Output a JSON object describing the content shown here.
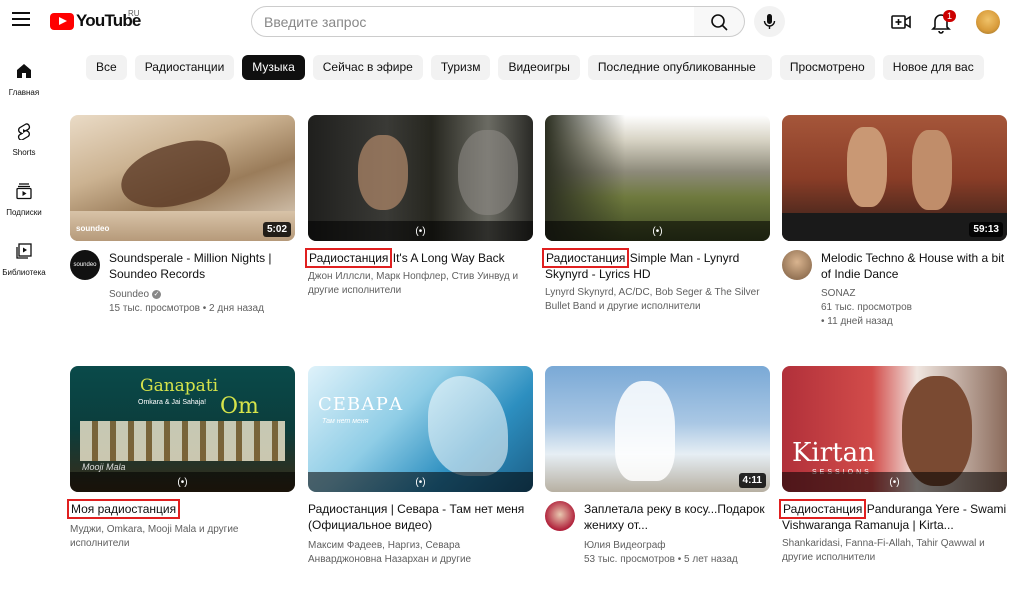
{
  "header": {
    "logo_text": "YouTube",
    "region": "RU",
    "search_placeholder": "Введите запрос",
    "notifications_count": "1"
  },
  "sidebar": {
    "items": [
      {
        "label": "Главная",
        "icon": "home-icon"
      },
      {
        "label": "Shorts",
        "icon": "shorts-icon"
      },
      {
        "label": "Подписки",
        "icon": "subscriptions-icon"
      },
      {
        "label": "Библиотека",
        "icon": "library-icon"
      }
    ]
  },
  "chips": [
    {
      "label": "Все",
      "active": false
    },
    {
      "label": "Радиостанции",
      "active": false
    },
    {
      "label": "Музыка",
      "active": true
    },
    {
      "label": "Сейчас в эфире",
      "active": false
    },
    {
      "label": "Туризм",
      "active": false
    },
    {
      "label": "Видеоигры",
      "active": false
    },
    {
      "label": "Последние опубликованные",
      "active": false
    },
    {
      "label": "Просмотрено",
      "active": false
    },
    {
      "label": "Новое для вас",
      "active": false
    }
  ],
  "videos": [
    {
      "badge": "",
      "title": "Soundsperale - Million Nights | Soundeo Records",
      "channel": "Soundeo",
      "verified": true,
      "stats": "15 тыс. просмотров • 2 дня назад",
      "duration": "5:02"
    },
    {
      "badge": "Радиостанция",
      "title": "It's A Long Way Back",
      "channel": "Джон Иллсли, Марк Нопфлер, Стив Уинвуд и другие исполнители",
      "stats": "",
      "duration": ""
    },
    {
      "badge": "Радиостанция",
      "title": "Simple Man - Lynyrd Skynyrd - Lyrics HD",
      "channel": "Lynyrd Skynyrd, AC/DC, Bob Seger & The Silver Bullet Band и другие исполнители",
      "stats": "",
      "duration": ""
    },
    {
      "badge": "",
      "title": "Melodic Techno & House with a bit of Indie Dance",
      "channel": "SONAZ",
      "stats": "61 тыс. просмотров",
      "stats2": "• 11 дней назад",
      "duration": "59:13"
    },
    {
      "badge": "Моя радиостанция",
      "title": "",
      "channel": "Муджи, Omkara, Mooji Mala и другие исполнители",
      "stats": "",
      "duration": ""
    },
    {
      "badge": "",
      "title": "Радиостанция | Севара - Там нет меня (Официальное видео)",
      "channel": "Максим Фадеев, Наргиз, Севара Анварджоновна Назархан и другие",
      "stats": "",
      "duration": ""
    },
    {
      "badge": "",
      "title": "Заплетала реку в косу...Подарок жениху от...",
      "channel": "Юлия Видеограф",
      "stats": "53 тыс. просмотров • 5 лет назад",
      "duration": "4:11"
    },
    {
      "badge": "Радиостанция",
      "title": "Panduranga Yere - Swami Vishwaranga Ramanuja | Kirta...",
      "channel": "Shankaridasi, Fanna-Fi-Allah, Tahir Qawwal и другие исполнители",
      "stats": "",
      "duration": ""
    }
  ],
  "thumb_texts": {
    "soundeo_mark": "soundeo",
    "ganapati": "Ganapati",
    "om": "Om",
    "omkara": "Omkara & Jai Sahaja!",
    "mooji": "Mooji Mala",
    "sevara": "СЕВАРА",
    "sevara_sub": "Там нет меня",
    "kirtan": "Kirtan",
    "kirtan_sub": "SESSIONS"
  }
}
